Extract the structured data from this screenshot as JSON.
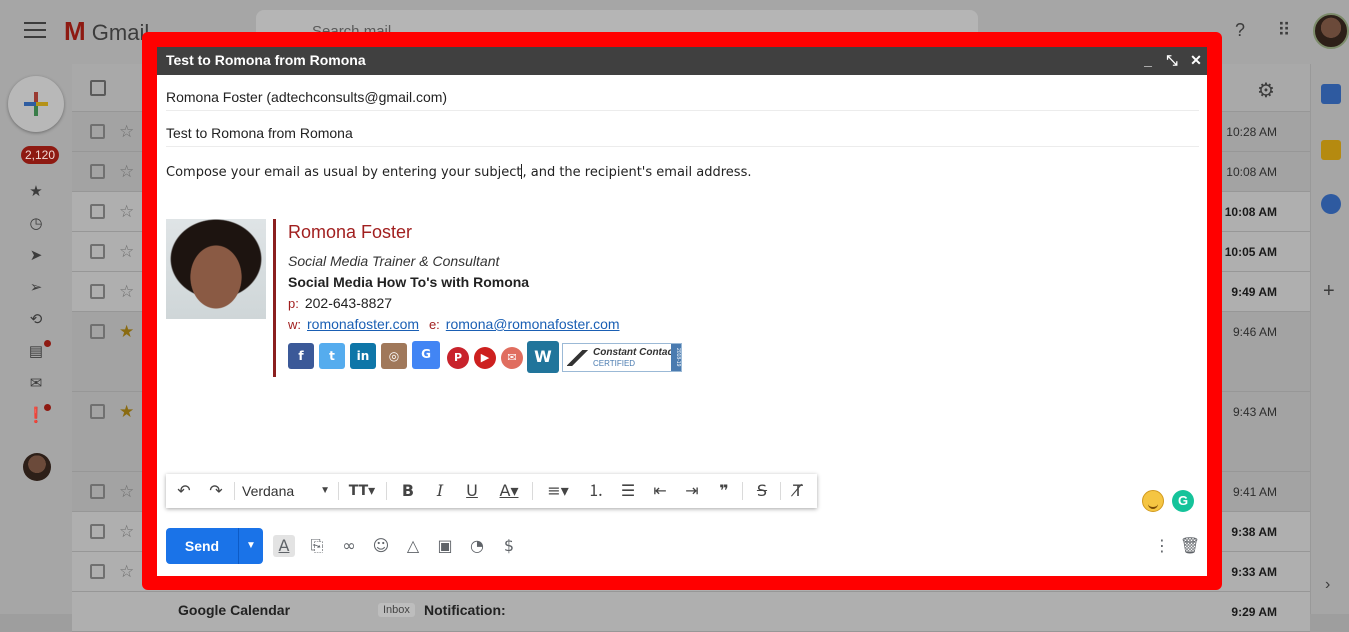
{
  "app": {
    "logo_text": "Gmail",
    "search_placeholder": "Search mail"
  },
  "nav": {
    "unread_count": "2,120"
  },
  "inbox": {
    "times": [
      "10:28 AM",
      "10:08 AM",
      "10:08 AM",
      "10:05 AM",
      "9:49 AM",
      "9:46 AM",
      "9:43 AM",
      "9:41 AM",
      "9:38 AM",
      "9:33 AM",
      "9:29 AM"
    ],
    "last_row": {
      "sender": "Google Calendar",
      "tag": "Inbox",
      "subject": "Notification:"
    }
  },
  "compose": {
    "title": "Test to Romona from Romona",
    "to": "Romona Foster (adtechconsults@gmail.com)",
    "subject": "Test to Romona from Romona",
    "body_before_caret": "Compose your email as usual by entering your subject",
    "body_after_caret": ", and the recipient's email address.",
    "signature": {
      "name": "Romona Foster",
      "title": "Social Media Trainer & Consultant",
      "company": "Social Media How To's with Romona",
      "phone_label": "p:",
      "phone": "202-643-8827",
      "web_label": "w:",
      "website": "romonafoster.com",
      "email_label": "e:",
      "email": "romona@romonafoster.com",
      "badge_title": "Constant Contact",
      "badge_sub": "CERTIFIED",
      "badge_year": "2018-19"
    },
    "toolbar": {
      "font": "Verdana"
    },
    "send_label": "Send"
  },
  "colors": {
    "frame": "#ff0000",
    "send": "#1a73e8",
    "title_bar": "#404040",
    "signature_accent": "#a11f1f"
  },
  "icons": [
    "undo-icon",
    "redo-icon",
    "text-size-icon",
    "bold-icon",
    "italic-icon",
    "underline-icon",
    "text-color-icon",
    "align-icon",
    "numbered-list-icon",
    "bulleted-list-icon",
    "indent-less-icon",
    "indent-more-icon",
    "quote-icon",
    "strikethrough-icon",
    "remove-formatting-icon",
    "attach-icon",
    "link-icon",
    "emoji-icon",
    "drive-icon",
    "photo-icon",
    "confidential-icon",
    "money-icon",
    "more-options-icon",
    "trash-icon"
  ]
}
